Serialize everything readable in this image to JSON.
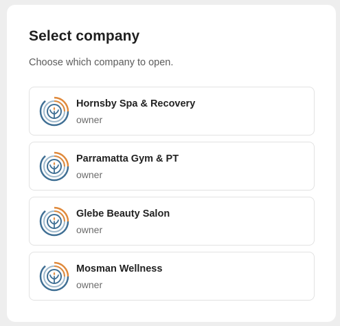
{
  "dialog": {
    "title": "Select company",
    "subtitle": "Choose which company to open."
  },
  "companies": [
    {
      "name": "Hornsby Spa & Recovery",
      "role": "owner",
      "icon": "company-logo-icon"
    },
    {
      "name": "Parramatta Gym & PT",
      "role": "owner",
      "icon": "company-logo-icon"
    },
    {
      "name": "Glebe Beauty Salon",
      "role": "owner",
      "icon": "company-logo-icon"
    },
    {
      "name": "Mosman Wellness",
      "role": "owner",
      "icon": "company-logo-icon"
    }
  ],
  "colors": {
    "logo_blue": "#3f6f94",
    "logo_orange": "#e08a3c",
    "logo_light": "#9fb9cc"
  }
}
